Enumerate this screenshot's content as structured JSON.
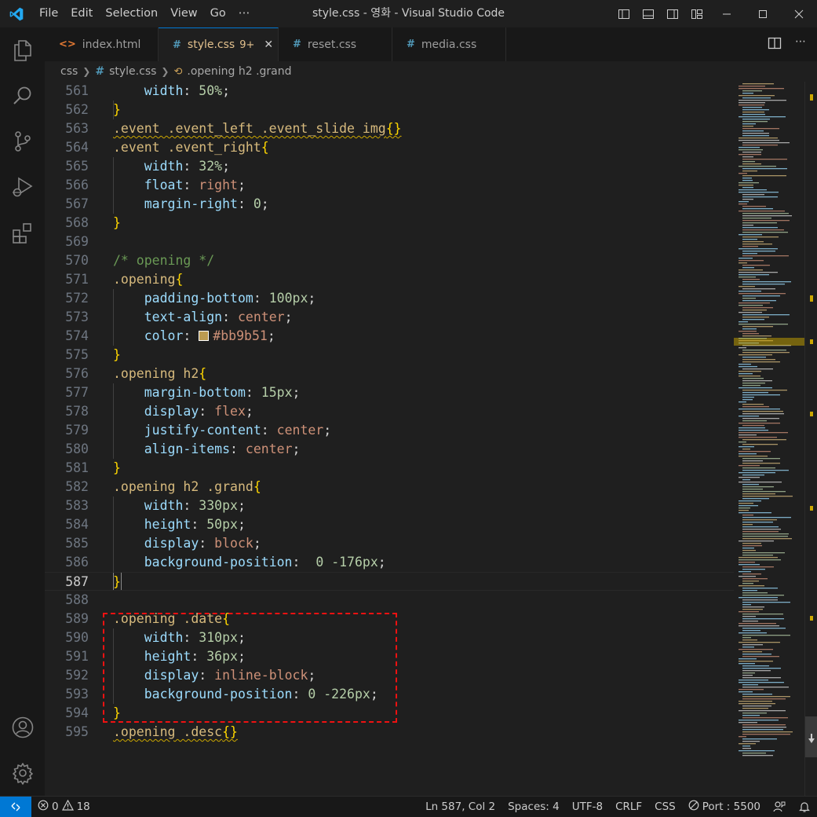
{
  "app": {
    "window_title": "style.css - 영화 - Visual Studio Code",
    "menu": [
      "File",
      "Edit",
      "Selection",
      "View",
      "Go",
      "⋯"
    ],
    "accent": "#0078d4"
  },
  "activity_bar": {
    "icons": [
      "explorer-icon",
      "search-icon",
      "source-control-icon",
      "run-debug-icon",
      "extensions-icon",
      "accounts-icon",
      "manage-gear-icon"
    ]
  },
  "tabs": [
    {
      "label": "index.html",
      "icon": "<>",
      "active": false
    },
    {
      "label": "style.css",
      "icon": "#",
      "badge": "9+",
      "active": true
    },
    {
      "label": "reset.css",
      "icon": "#",
      "active": false
    },
    {
      "label": "media.css",
      "icon": "#",
      "active": false
    }
  ],
  "breadcrumb": {
    "folder": "css",
    "file": "style.css",
    "symbol": ".opening h2 .grand"
  },
  "editor": {
    "current_line": 587,
    "lines": [
      {
        "n": "561",
        "code": "    width: 50%;"
      },
      {
        "n": "562",
        "code": "}"
      },
      {
        "n": "563",
        "code": ".event .event_left .event_slide img{}"
      },
      {
        "n": "564",
        "code": ".event .event_right{"
      },
      {
        "n": "565",
        "code": "    width: 32%;"
      },
      {
        "n": "566",
        "code": "    float: right;"
      },
      {
        "n": "567",
        "code": "    margin-right: 0;"
      },
      {
        "n": "568",
        "code": "}"
      },
      {
        "n": "569",
        "code": ""
      },
      {
        "n": "570",
        "code": "/* opening */"
      },
      {
        "n": "571",
        "code": ".opening{"
      },
      {
        "n": "572",
        "code": "    padding-bottom: 100px;"
      },
      {
        "n": "573",
        "code": "    text-align: center;"
      },
      {
        "n": "574",
        "code": "    color: #bb9b51;"
      },
      {
        "n": "575",
        "code": "}"
      },
      {
        "n": "576",
        "code": ".opening h2{"
      },
      {
        "n": "577",
        "code": "    margin-bottom: 15px;"
      },
      {
        "n": "578",
        "code": "    display: flex;"
      },
      {
        "n": "579",
        "code": "    justify-content: center;"
      },
      {
        "n": "580",
        "code": "    align-items: center;"
      },
      {
        "n": "581",
        "code": "}"
      },
      {
        "n": "582",
        "code": ".opening h2 .grand{"
      },
      {
        "n": "583",
        "code": "    width: 330px;"
      },
      {
        "n": "584",
        "code": "    height: 50px;"
      },
      {
        "n": "585",
        "code": "    display: block;"
      },
      {
        "n": "586",
        "code": "    background-position:  0 -176px;"
      },
      {
        "n": "587",
        "code": "}"
      },
      {
        "n": "588",
        "code": ""
      },
      {
        "n": "589",
        "code": ".opening .date{"
      },
      {
        "n": "590",
        "code": "    width: 310px;"
      },
      {
        "n": "591",
        "code": "    height: 36px;"
      },
      {
        "n": "592",
        "code": "    display: inline-block;"
      },
      {
        "n": "593",
        "code": "    background-position: 0 -226px;"
      },
      {
        "n": "594",
        "code": "}"
      },
      {
        "n": "595",
        "code": ".opening .desc{}"
      }
    ],
    "color_swatch": "#bb9b51"
  },
  "status_bar": {
    "errors": "0",
    "warnings": "18",
    "position": "Ln 587, Col 2",
    "spaces": "Spaces: 4",
    "encoding": "UTF-8",
    "eol": "CRLF",
    "language": "CSS",
    "port": "Port : 5500"
  }
}
